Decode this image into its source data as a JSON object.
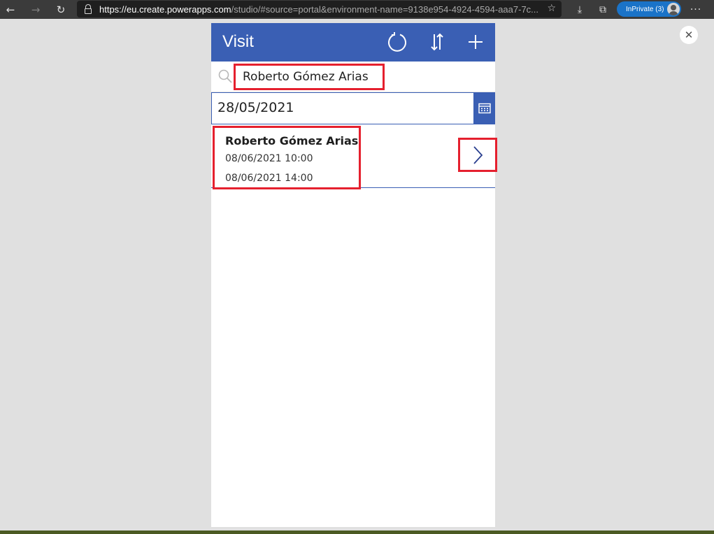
{
  "browser": {
    "url_host": "https://eu.create.powerapps.com",
    "url_rest": "/studio/#source=portal&environment-name=9138e954-4924-4594-aaa7-7c...",
    "inprivate_label": "InPrivate (3)"
  },
  "app": {
    "title": "Visit",
    "search": {
      "value": "Roberto Gómez Arias"
    },
    "date_filter": {
      "value": "28/05/2021"
    },
    "items": [
      {
        "name": "Roberto Gómez Arias",
        "start": "08/06/2021 10:00",
        "end": "08/06/2021 14:00"
      }
    ]
  },
  "icons": {
    "back": "arrow-left-icon",
    "forward": "arrow-right-icon",
    "reload": "reload-icon",
    "refresh": "refresh-icon",
    "sort": "sort-icon",
    "add": "plus-icon",
    "calendar": "calendar-icon",
    "next": "chevron-right-icon",
    "close": "close-icon"
  },
  "colors": {
    "header": "#3a5fb4",
    "highlight": "#e5202e",
    "browser_bar": "#3b3b3b",
    "inprivate": "#1a73c8"
  }
}
